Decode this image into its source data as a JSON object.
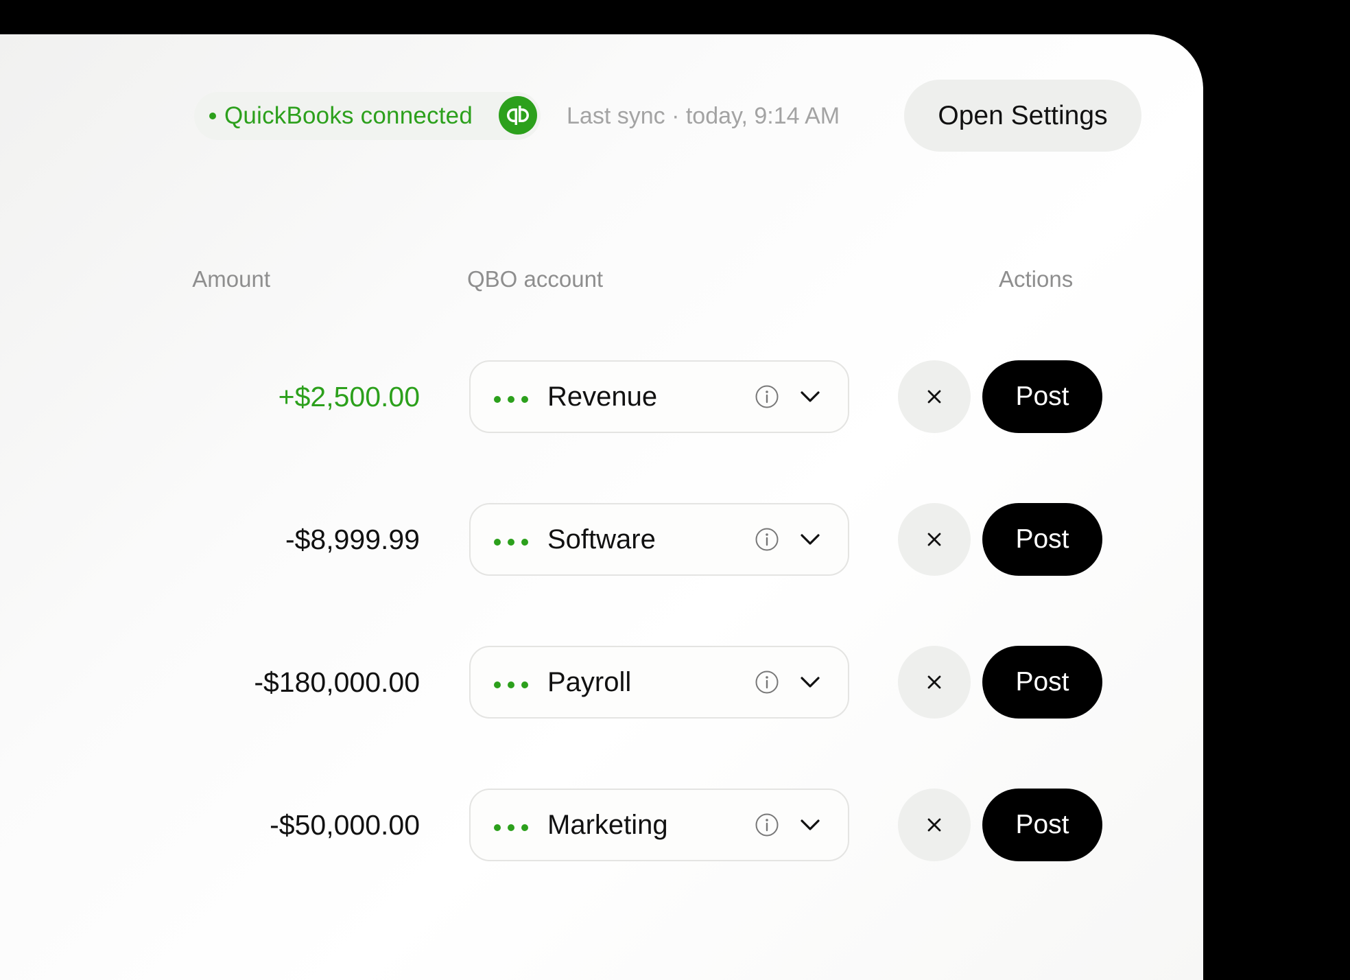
{
  "colors": {
    "green": "#2ca01c",
    "black": "#000000",
    "muted_text": "#8e8e8e",
    "pill_bg": "#eeefed"
  },
  "header": {
    "status_label": "QuickBooks connected",
    "logo_icon": "quickbooks-logo-icon",
    "last_sync": "Last sync · today, 9:14 AM",
    "settings_label": "Open Settings"
  },
  "table": {
    "columns": {
      "amount": "Amount",
      "account": "QBO account",
      "actions": "Actions"
    },
    "rows": [
      {
        "amount": "+$2,500.00",
        "account": "Revenue",
        "post_label": "Post"
      },
      {
        "amount": "-$8,999.99",
        "account": "Software",
        "post_label": "Post"
      },
      {
        "amount": "-$180,000.00",
        "account": "Payroll",
        "post_label": "Post"
      },
      {
        "amount": "-$50,000.00",
        "account": "Marketing",
        "post_label": "Post"
      }
    ]
  }
}
